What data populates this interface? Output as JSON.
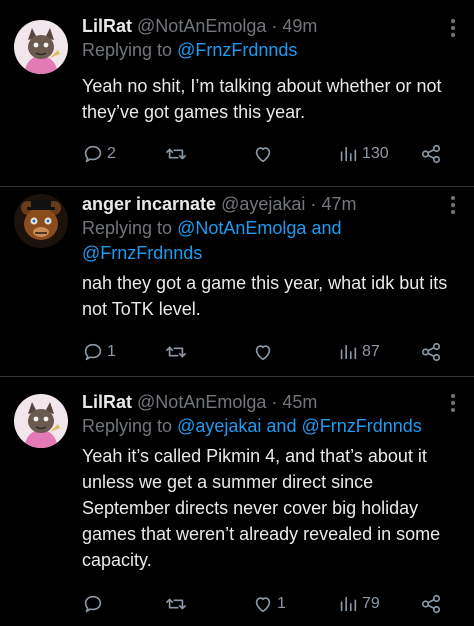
{
  "tweets": [
    {
      "name": "LilRat",
      "handle": "@NotAnEmolga",
      "dot": "·",
      "time": "49m",
      "replying_prefix": "Replying to",
      "mentions": [
        "@FrnzFrdnnds"
      ],
      "body": "Yeah no shit, I’m talking about whether or not they’ve got games this year.",
      "replies": "2",
      "retweets": "",
      "likes": "",
      "views": "130",
      "avatar": "rat-cartoon-avatar"
    },
    {
      "name": "anger incarnate",
      "handle": "@ayejakai",
      "dot": "·",
      "time": "47m",
      "replying_prefix": "Replying to",
      "mentions": [
        "@NotAnEmolga",
        "and",
        "@FrnzFrdnnds"
      ],
      "body": "nah they got a game this year, what idk but its not ToTK level.",
      "replies": "1",
      "retweets": "",
      "likes": "",
      "views": "87",
      "avatar": "animatronic-bear-avatar"
    },
    {
      "name": "LilRat",
      "handle": "@NotAnEmolga",
      "dot": "·",
      "time": "45m",
      "replying_prefix": "Replying to",
      "mentions": [
        "@ayejakai",
        "and",
        "@FrnzFrdnnds"
      ],
      "body": "Yeah it’s called Pikmin 4, and that’s about it unless we get a summer direct since September directs never cover big holiday games that weren’t already revealed in some capacity.",
      "replies": "",
      "retweets": "",
      "likes": "1",
      "views": "79",
      "avatar": "rat-cartoon-avatar"
    }
  ],
  "colors": {
    "background": "#000000",
    "text": "#e7e9ea",
    "muted": "#71767b",
    "mention": "#1d9bf0",
    "icon": "#8b98a5",
    "divider": "#2f3336"
  }
}
